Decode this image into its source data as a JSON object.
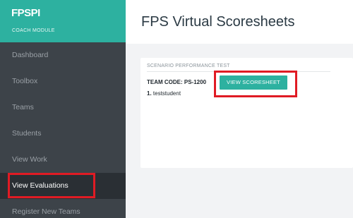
{
  "brand": {
    "logo": "FPSPI",
    "subtitle": "COACH MODULE"
  },
  "sidebar": {
    "items": [
      {
        "label": "Dashboard"
      },
      {
        "label": "Toolbox"
      },
      {
        "label": "Teams"
      },
      {
        "label": "Students"
      },
      {
        "label": "View Work"
      },
      {
        "label": "View Evaluations"
      },
      {
        "label": "Register New Teams"
      }
    ],
    "active_item": "View Evaluations"
  },
  "header": {
    "title": "FPS Virtual Scoresheets"
  },
  "card": {
    "section_title": "SCENARIO PERFORMANCE TEST",
    "team_code": "TEAM CODE: PS-1200",
    "button_label": "VIEW SCORESHEET",
    "students": [
      {
        "number": "1.",
        "name": "teststudent"
      }
    ]
  },
  "colors": {
    "accent": "#2db1a0",
    "sidebar_bg": "#3d4349",
    "highlight_border": "#e01b24"
  }
}
